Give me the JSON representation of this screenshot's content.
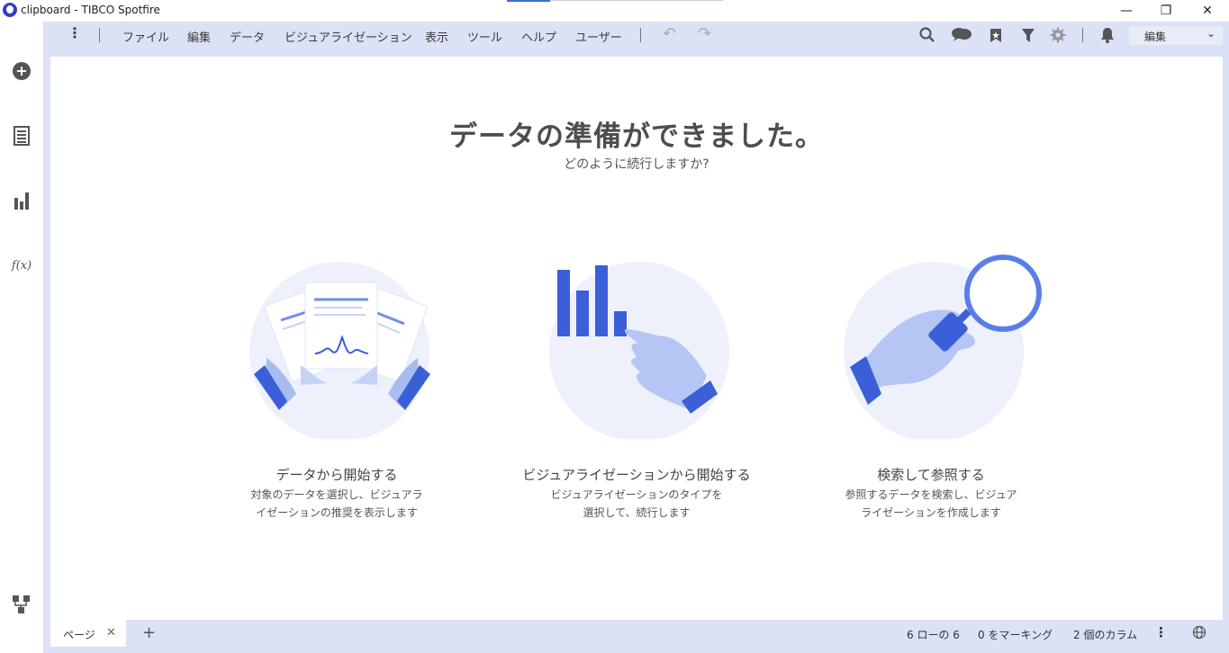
{
  "window": {
    "title": "clipboard - TIBCO Spotfire",
    "minimize": "—",
    "restore": "❐",
    "close": "✕"
  },
  "menu": {
    "more": "⋮",
    "items": [
      "ファイル",
      "編集",
      "データ",
      "ビジュアライゼーション",
      "表示",
      "ツール",
      "ヘルプ",
      "ユーザー"
    ],
    "undo": "↶",
    "redo": "↷"
  },
  "toolbar": {
    "icons": [
      "search-icon",
      "comments-icon",
      "bookmark-icon",
      "filter-icon",
      "settings-icon",
      "notification-icon"
    ],
    "mode_select": "編集",
    "mode_chevron": "⌄"
  },
  "sidebar": {
    "icons": [
      "add-icon",
      "data-table-icon",
      "visualization-icon",
      "expression-icon",
      "data-canvas-icon"
    ],
    "fx": "f(x)"
  },
  "welcome": {
    "title": "データの準備ができました。",
    "subtitle": "どのように続行しますか?",
    "cards": [
      {
        "title": "データから開始する",
        "desc_line1": "対象のデータを選択し、ビジュアラ",
        "desc_line2": "イゼーションの推奨を表示します"
      },
      {
        "title": "ビジュアライゼーションから開始する",
        "desc_line1": "ビジュアライゼーションのタイプを",
        "desc_line2": "選択して、続行します"
      },
      {
        "title": "検索して参照する",
        "desc_line1": "参照するデータを検索し、ビジュア",
        "desc_line2": "ライゼーションを作成します"
      }
    ]
  },
  "statusbar": {
    "page_tab": "ページ",
    "close_tab": "✕",
    "add_page": "+",
    "rows": "6 ローの 6",
    "marking": "0 をマーキング",
    "columns": "2 個のカラム",
    "more": "⋮"
  },
  "colors": {
    "accent": "#3a5fd9",
    "light_accent": "#eef1fc",
    "frame": "#dbe2f6"
  }
}
